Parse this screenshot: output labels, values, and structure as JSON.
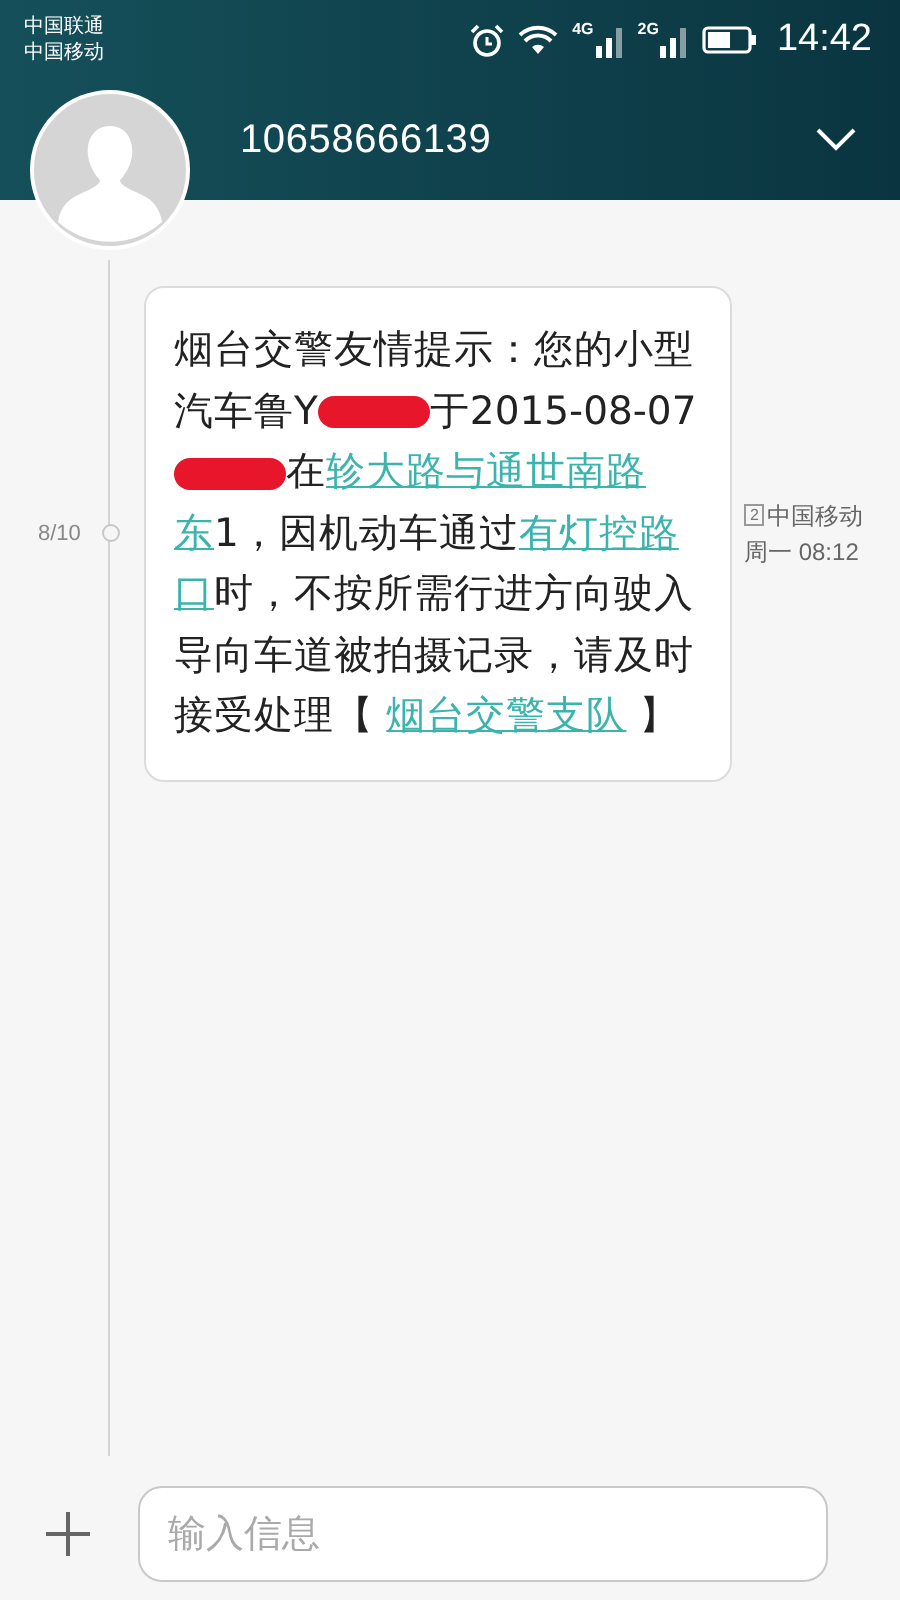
{
  "status_bar": {
    "carriers": [
      "中国联通",
      "中国移动"
    ],
    "networks": [
      {
        "label": "4G"
      },
      {
        "label": "2G"
      }
    ],
    "time": "14:42"
  },
  "header": {
    "contact": "10658666139"
  },
  "messages": [
    {
      "date": "8/10",
      "sim_slot": "2",
      "carrier": "中国移动",
      "time": "周一 08:12",
      "lines": [
        [
          {
            "kind": "text",
            "text": "烟台交警友情提示：您的小型"
          }
        ],
        [
          {
            "kind": "text",
            "text": "汽车鲁Y"
          },
          {
            "kind": "redacted"
          },
          {
            "kind": "text",
            "text": "于2015-08-07"
          }
        ],
        [
          {
            "kind": "redacted"
          },
          {
            "kind": "text",
            "text": "在"
          },
          {
            "kind": "link",
            "text": "轸大路与通世南路"
          }
        ],
        [
          {
            "kind": "link",
            "text": "东"
          },
          {
            "kind": "text",
            "text": "1，因机动车通过"
          },
          {
            "kind": "link",
            "text": "有灯控路"
          }
        ],
        [
          {
            "kind": "link",
            "text": "口"
          },
          {
            "kind": "text",
            "text": "时，不按所需行进方向驶入"
          }
        ],
        [
          {
            "kind": "text",
            "text": "导向车道被拍摄记录，请及时"
          }
        ],
        [
          {
            "kind": "text",
            "text": "接受处理【 "
          },
          {
            "kind": "link",
            "text": "烟台交警支队"
          },
          {
            "kind": "text",
            "text": " 】"
          }
        ]
      ]
    }
  ],
  "composer": {
    "placeholder": "输入信息"
  }
}
